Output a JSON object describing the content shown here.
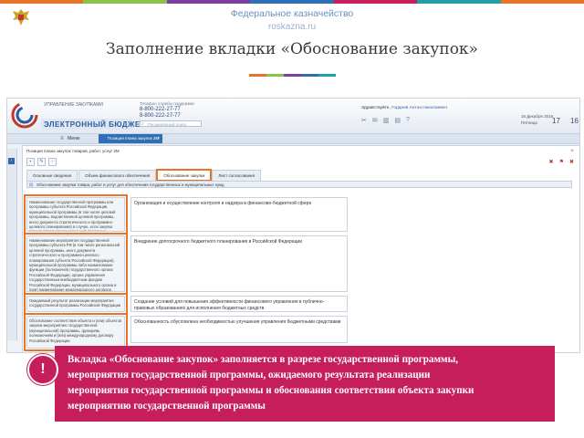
{
  "slide": {
    "org_name": "Федеральное казначейство",
    "site": "roskazna.ru",
    "title": "Заполнение вкладки «Обоснование закупок»",
    "accent_colors": [
      "#e8742a",
      "#8bc34a",
      "#7b3fa0",
      "#2f6fb6",
      "#c51e5a",
      "#1fa0a8"
    ]
  },
  "app": {
    "sub_org": "УПРАВЛЕНИЕ ЗАКУПКАМИ",
    "title": "ЭЛЕКТРОННЫЙ БЮДЖЕТ",
    "helpdesk_label": "Телефон службы поддержки",
    "phone1": "8-800-222-27-77",
    "phone2": "8-800-222-27-77",
    "search_placeholder": "Расширенный поиск",
    "greeting": "Здравствуйте,",
    "user": "Гордеев Антон Николаевич",
    "date_line1": "16 Декабря 2016",
    "date_line2": "Пятница",
    "big_date1": "17",
    "big_date2": "16",
    "menu_label": "Меню",
    "doc_tab_label": "Позиция плана закупок 2М",
    "header_icons": [
      "tools-icon",
      "mail-icon",
      "chart-icon",
      "document-icon",
      "help-icon"
    ]
  },
  "panel": {
    "title": "Позиция плана закупок товаров, работ, услуг 2М",
    "tabs": [
      "Основные сведения",
      "Объем финансового обеспечения",
      "Обоснование закупки",
      "Лист согласования"
    ],
    "active_tab": "Обоснование закупки",
    "info_bar": "Обоснование закупки товара, работ и услуг для обеспечения государственных и муниципальных нужд",
    "rows": [
      {
        "label": "Наименование государственной программы или программы субъекта Российской Федерации, муниципальной программы (в том числе целевой программы, ведомственной целевой программы, иного документа стратегического и программно-целевого планирования) в случае, если закупка планируется в рамках указанной программы",
        "value": "Организация и осуществление контроля и надзора в финансово-бюджетной сфере"
      },
      {
        "label": "Наименование мероприятия государственной программы субъекта РФ (в том числе региональной целевой программы, иного документа стратегического и программно-целевого планирования субъекта Российской Федерации), муниципальной программы либо наименование функции (полномочия) государственного органа Российской Федерации, органа управления государственным внебюджетным фондом Российской Федерации, муниципального органа и (или) наименование международного договора Российской Федерации",
        "value": "Внедрение долгосрочного бюджетного планирования в Российской Федерации"
      },
      {
        "label": "Ожидаемый результат реализации мероприятия государственной программы Российской Федерации",
        "value": "Создание условий для повышения эффективности финансового управления в публично-правовых образованиях для исполнения бюджетных средств"
      },
      {
        "label": "Обоснование соответствия объекта и (или) объектов закупки мероприятию государственной (муниципальной) программы, функциям, полномочиям и (или) международному договору Российской Федерации",
        "value": "Обоснованность обусловлена необходимостью улучшения управления бюджетными средствами"
      }
    ]
  },
  "callout": {
    "icon_text": "!",
    "lines": [
      "Вкладка «Обоснование закупок» заполняется в разрезе государственной программы,",
      "мероприятия государственной программы, ожидаемого результата реализации",
      "мероприятия государственной программы и обоснования соответствия объекта закупки",
      "мероприятию государственной программы"
    ]
  }
}
